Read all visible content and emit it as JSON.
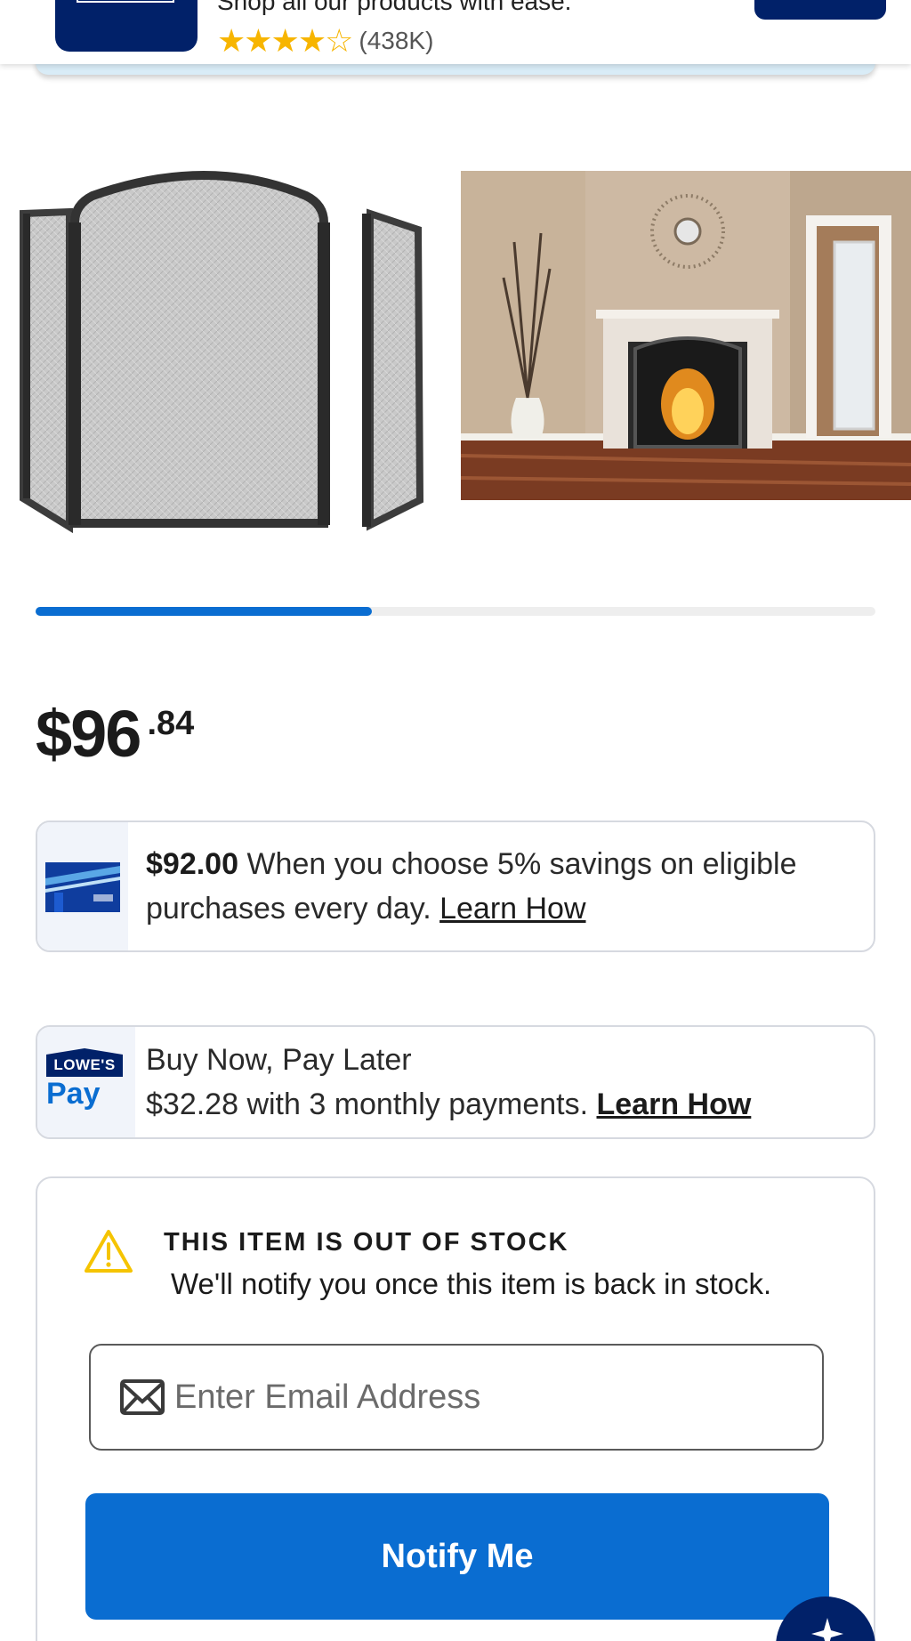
{
  "app_banner": {
    "subtitle": "Shop all our products with ease.",
    "stars": "★★★★☆",
    "rating_count": "(438K)"
  },
  "gallery": {
    "progress_fraction": 0.4,
    "images": [
      "fireplace-screen-product-photo",
      "fireplace-screen-room-photo"
    ]
  },
  "price": {
    "dollars": "$96",
    "cents": ".84"
  },
  "rewards_offer": {
    "price": "$92.00",
    "text": " When you choose 5% savings on eligible purchases every day. ",
    "link": "Learn How",
    "icon": "mylowes-rewards-card-icon"
  },
  "pay_later": {
    "logo_top": "LOWE'S",
    "logo_bottom": "Pay",
    "title": "Buy Now, Pay Later",
    "text": "$32.28 with 3 monthly payments. ",
    "link": "Learn How"
  },
  "stock": {
    "title": "THIS ITEM IS OUT OF STOCK",
    "message": "We'll notify you once this item is back in stock.",
    "email_placeholder": "Enter Email Address",
    "email_value": "",
    "button_label": "Notify Me"
  },
  "colors": {
    "brand_navy": "#012169",
    "action_blue": "#0a6dd1",
    "warning_yellow": "#f5c400",
    "star_gold": "#f7b500"
  },
  "fab": {
    "icon": "sparkle-icon"
  }
}
